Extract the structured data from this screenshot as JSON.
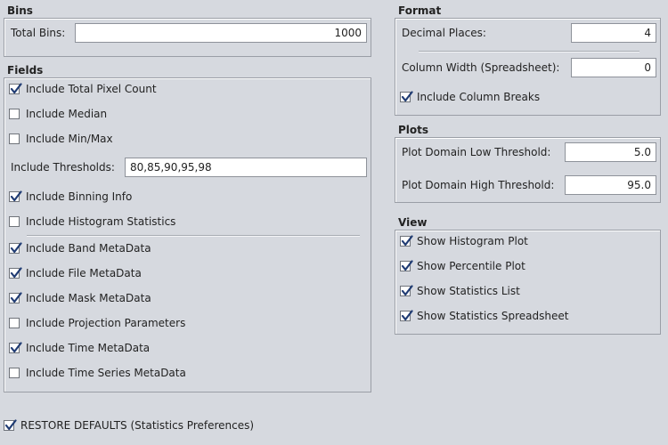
{
  "bins": {
    "title": "Bins",
    "total_bins_label": "Total Bins:",
    "total_bins_value": "1000"
  },
  "fields": {
    "title": "Fields",
    "include_total_pixel_count": {
      "label": "Include Total Pixel Count",
      "checked": true
    },
    "include_median": {
      "label": "Include Median",
      "checked": false
    },
    "include_min_max": {
      "label": "Include Min/Max",
      "checked": false
    },
    "thresholds_label": "Include Thresholds:",
    "thresholds_value": "80,85,90,95,98",
    "include_binning_info": {
      "label": "Include Binning Info",
      "checked": true
    },
    "include_histogram_statistics": {
      "label": "Include Histogram Statistics",
      "checked": false
    },
    "include_band_metadata": {
      "label": "Include Band MetaData",
      "checked": true
    },
    "include_file_metadata": {
      "label": "Include File MetaData",
      "checked": true
    },
    "include_mask_metadata": {
      "label": "Include Mask MetaData",
      "checked": true
    },
    "include_projection_parameters": {
      "label": "Include Projection Parameters",
      "checked": false
    },
    "include_time_metadata": {
      "label": "Include Time MetaData",
      "checked": true
    },
    "include_time_series_metadata": {
      "label": "Include Time Series MetaData",
      "checked": false
    }
  },
  "format": {
    "title": "Format",
    "decimal_places_label": "Decimal Places:",
    "decimal_places_value": "4",
    "column_width_label": "Column Width (Spreadsheet):",
    "column_width_value": "0",
    "include_column_breaks": {
      "label": "Include Column Breaks",
      "checked": true
    }
  },
  "plots": {
    "title": "Plots",
    "low_threshold_label": "Plot Domain Low Threshold:",
    "low_threshold_value": "5.0",
    "high_threshold_label": "Plot Domain High Threshold:",
    "high_threshold_value": "95.0"
  },
  "view": {
    "title": "View",
    "show_histogram_plot": {
      "label": "Show Histogram Plot",
      "checked": true
    },
    "show_percentile_plot": {
      "label": "Show Percentile Plot",
      "checked": true
    },
    "show_statistics_list": {
      "label": "Show Statistics List",
      "checked": true
    },
    "show_statistics_spreadsheet": {
      "label": "Show Statistics Spreadsheet",
      "checked": true
    }
  },
  "restore_defaults": {
    "label": "RESTORE DEFAULTS (Statistics Preferences)",
    "checked": true
  },
  "colors": {
    "background": "#d6d9df",
    "check_mark": "#1f3b73"
  }
}
